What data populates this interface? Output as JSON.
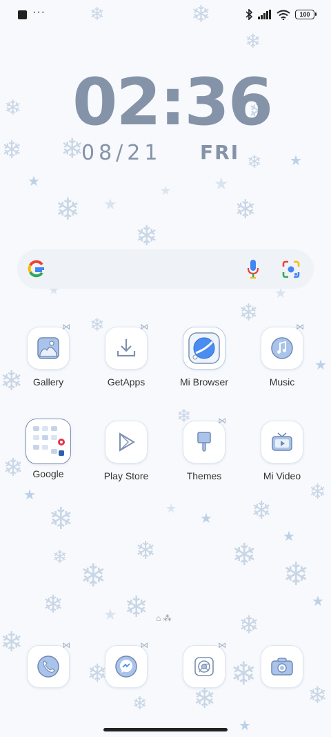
{
  "status_bar": {
    "dots": "···",
    "battery": "100"
  },
  "clock": {
    "time": "02:36",
    "date": "08/21",
    "weekday": "FRI"
  },
  "search": {
    "placeholder": ""
  },
  "apps": [
    {
      "label": "Gallery",
      "icon": "gallery-icon"
    },
    {
      "label": "GetApps",
      "icon": "download-icon"
    },
    {
      "label": "Mi Browser",
      "icon": "browser-icon"
    },
    {
      "label": "Music",
      "icon": "music-icon"
    },
    {
      "label": "Google",
      "icon": "google-folder-icon"
    },
    {
      "label": "Play Store",
      "icon": "play-store-icon"
    },
    {
      "label": "Themes",
      "icon": "themes-icon"
    },
    {
      "label": "Mi Video",
      "icon": "tv-icon"
    }
  ],
  "dock": [
    {
      "icon": "phone-icon"
    },
    {
      "icon": "messaging-icon"
    },
    {
      "icon": "chrome-icon"
    },
    {
      "icon": "camera-icon"
    }
  ],
  "colors": {
    "clock": "#8593a8",
    "accent_blue": "#4a8cf0",
    "icon_stroke": "#7d90b0"
  }
}
